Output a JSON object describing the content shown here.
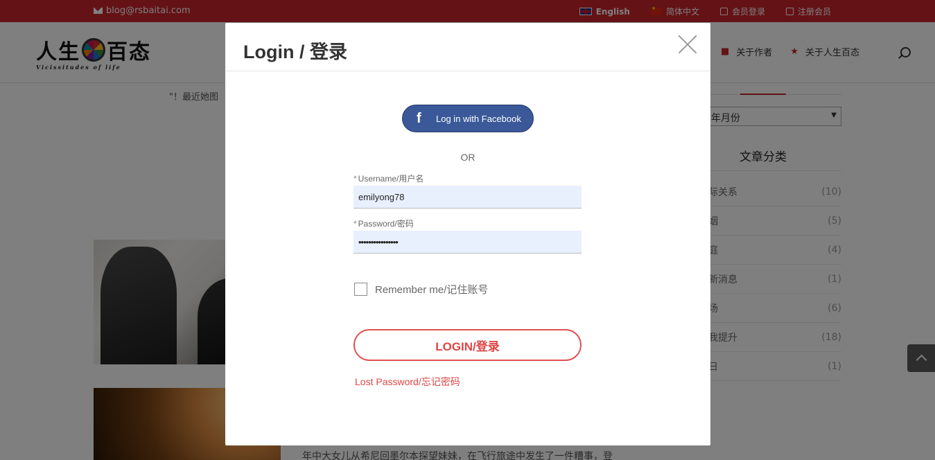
{
  "topbar": {
    "email": "blog@rsbaitai.com",
    "lang_en": "English",
    "lang_zh": "简体中文",
    "member_login": "会员登录",
    "register": "注册会员"
  },
  "header": {
    "logo_zh": "人生百态",
    "logo_en": "Vicissitudes of life",
    "nav": [
      "关于作者",
      "关于人生百态"
    ]
  },
  "content": {
    "snippet": "\"！最近她图",
    "article_text": "年中大女儿从希尼回墨尔本探望妹妹，在飞行旅途中发生了一件糟事，登"
  },
  "sidebar": {
    "archive_select": "年月份",
    "categories_title": "文章分类",
    "categories": [
      {
        "name": "际关系",
        "count": "(10)"
      },
      {
        "name": "姻",
        "count": "(5)"
      },
      {
        "name": "庭",
        "count": "(4)"
      },
      {
        "name": "新消息",
        "count": "(1)"
      },
      {
        "name": "场",
        "count": "(6)"
      },
      {
        "name": "我提升",
        "count": "(18)"
      },
      {
        "name": "日",
        "count": "(1)"
      }
    ]
  },
  "modal": {
    "title": "Login / 登录",
    "facebook_label": "Log in with Facebook",
    "or_text": "OR",
    "username_label": "Username/用户名",
    "username_value": "emilyong78",
    "password_label": "Password/密码",
    "password_value": "••••••••••••••••",
    "required_mark": "*",
    "remember_label": "Remember me/记住账号",
    "login_button": "LOGIN/登录",
    "lost_password": "Lost Password/忘记密码"
  },
  "colors": {
    "brand_red": "#c8252c",
    "facebook_blue": "#3b5998",
    "login_red": "#e04545",
    "autofill_blue": "#e8f0fe"
  }
}
